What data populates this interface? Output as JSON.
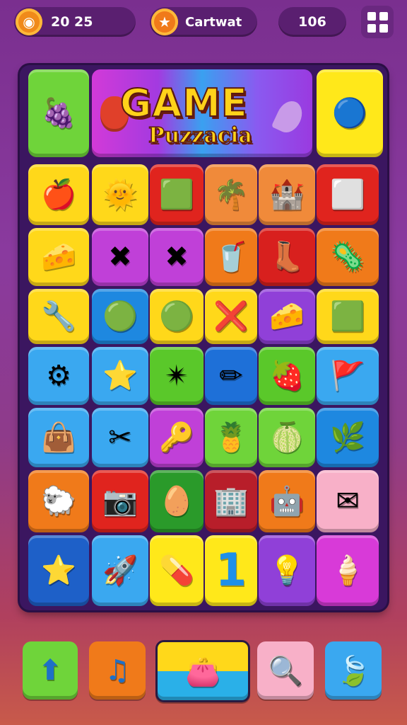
{
  "hud": {
    "score_value": "20 25",
    "player_name": "Cartwat",
    "counter_value": "106",
    "coin_icon": "coin-icon",
    "star_icon": "star-badge-icon",
    "menu_icon": "grid-menu-icon"
  },
  "title_banner": {
    "title": "GAME",
    "subtitle": "Puzzacia"
  },
  "board": {
    "rows": [
      [
        {
          "icon": "grape-icon",
          "glyph": "🍇",
          "color": "#6fd43a"
        },
        {
          "span": "banner"
        },
        {
          "icon": "blue-orb-icon",
          "glyph": "🔵",
          "color": "#ffe81a"
        }
      ],
      [
        {
          "icon": "apple-icon",
          "glyph": "🍎",
          "color": "#ffd81a"
        },
        {
          "icon": "sun-icon",
          "glyph": "🌞",
          "color": "#ffd81a"
        },
        {
          "icon": "card-icon",
          "glyph": "🟩",
          "color": "#e0241e"
        },
        {
          "icon": "palm-icon",
          "glyph": "🌴",
          "color": "#f08a3a"
        },
        {
          "icon": "castle-icon",
          "glyph": "🏰",
          "color": "#f08a3a"
        },
        {
          "icon": "face-icon",
          "glyph": "⬜",
          "color": "#e0241e"
        }
      ],
      [
        {
          "icon": "cheese-icon",
          "glyph": "🧀",
          "color": "#ffd81a"
        },
        {
          "icon": "cross-icon",
          "glyph": "✖",
          "color": "#c040d8"
        },
        {
          "icon": "cross-icon",
          "glyph": "✖",
          "color": "#c040d8"
        },
        {
          "icon": "cup-icon",
          "glyph": "🥤",
          "color": "#f07a1a"
        },
        {
          "icon": "boot-icon",
          "glyph": "👢",
          "color": "#d8201e"
        },
        {
          "icon": "virus-icon",
          "glyph": "🦠",
          "color": "#f07a1a"
        }
      ],
      [
        {
          "icon": "wrench-icon",
          "glyph": "🔧",
          "color": "#ffd81a"
        },
        {
          "icon": "blob-icon",
          "glyph": "🟢",
          "color": "#1e88e0"
        },
        {
          "icon": "circle-icon",
          "glyph": "🟢",
          "color": "#ffd81a"
        },
        {
          "icon": "x-icon",
          "glyph": "❌",
          "color": "#ffd81a"
        },
        {
          "icon": "cheese-block-icon",
          "glyph": "🧀",
          "color": "#9040d8"
        },
        {
          "icon": "box-icon",
          "glyph": "🟩",
          "color": "#ffd81a"
        }
      ],
      [
        {
          "icon": "gear-icon",
          "glyph": "⚙",
          "color": "#3aa8f0"
        },
        {
          "icon": "star-icon",
          "glyph": "⭐",
          "color": "#3aa8f0"
        },
        {
          "icon": "spark-icon",
          "glyph": "✴",
          "color": "#5ac82a"
        },
        {
          "icon": "pencil-icon",
          "glyph": "✏",
          "color": "#1e70d8"
        },
        {
          "icon": "heart-fruit-icon",
          "glyph": "🍓",
          "color": "#5ac82a"
        },
        {
          "icon": "flag-icon",
          "glyph": "🚩",
          "color": "#3aa8f0"
        }
      ],
      [
        {
          "icon": "bag-icon",
          "glyph": "👜",
          "color": "#3aa8f0"
        },
        {
          "icon": "crossed-tools-icon",
          "glyph": "✂",
          "color": "#3aa8f0"
        },
        {
          "icon": "key-icon",
          "glyph": "🔑",
          "color": "#c040d8"
        },
        {
          "icon": "pineapple-icon",
          "glyph": "🍍",
          "color": "#6fd43a"
        },
        {
          "icon": "lime-icon",
          "glyph": "🍈",
          "color": "#6fd43a"
        },
        {
          "icon": "leaf-icon",
          "glyph": "🌿",
          "color": "#1e88e0"
        }
      ],
      [
        {
          "icon": "sheep-icon",
          "glyph": "🐑",
          "color": "#f07a1a"
        },
        {
          "icon": "camera-icon",
          "glyph": "📷",
          "color": "#e0241e"
        },
        {
          "icon": "egg-icon",
          "glyph": "🥚",
          "color": "#2a9a2a"
        },
        {
          "icon": "building-icon",
          "glyph": "🏢",
          "color": "#b81e2a"
        },
        {
          "icon": "robot-icon",
          "glyph": "🤖",
          "color": "#f07a1a"
        },
        {
          "icon": "envelope-icon",
          "glyph": "✉",
          "color": "#f8b0c8"
        }
      ],
      [
        {
          "icon": "gold-star-icon",
          "glyph": "⭐",
          "color": "#1e60c8"
        },
        {
          "icon": "rocket-icon",
          "glyph": "🚀",
          "color": "#3aa8f0"
        },
        {
          "icon": "candy-icon",
          "glyph": "💊",
          "color": "#ffe81a"
        },
        {
          "icon": "number-one-icon",
          "glyph": "1",
          "color": "#ffe81a"
        },
        {
          "icon": "bulb-icon",
          "glyph": "💡",
          "color": "#9040d8"
        },
        {
          "icon": "ice-cream-icon",
          "glyph": "🍦",
          "color": "#d83ad8"
        }
      ]
    ]
  },
  "bottom_bar": [
    {
      "name": "up-arrow-button",
      "icon": "up-arrow-icon",
      "glyph": "⬆",
      "color": "#6fd43a"
    },
    {
      "name": "music-button",
      "icon": "music-note-icon",
      "glyph": "♫",
      "color": "#f07a1a"
    },
    {
      "name": "shop-button",
      "icon": "wallet-icon",
      "glyph": "👛",
      "color": "#ffd81a"
    },
    {
      "name": "search-button",
      "icon": "magnifier-icon",
      "glyph": "🔍",
      "color": "#f8b0c8"
    },
    {
      "name": "leaf-button",
      "icon": "leaf-icon",
      "glyph": "🍃",
      "color": "#3aa8f0"
    }
  ]
}
